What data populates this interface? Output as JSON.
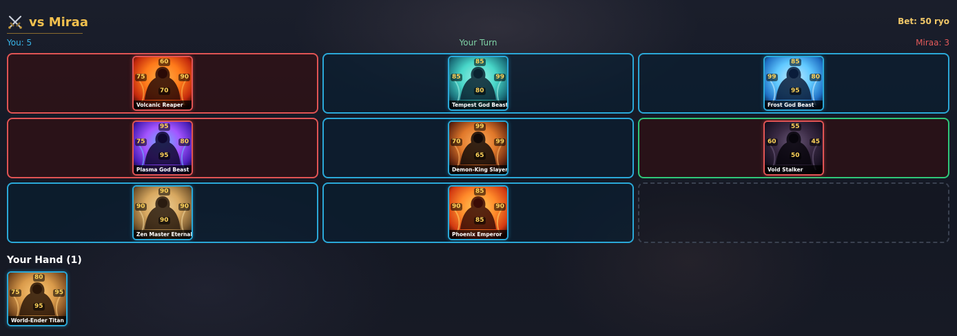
{
  "header": {
    "title_icon": "crossed-swords-icon",
    "title": "vs Miraa",
    "bet": "Bet: 50 ryo"
  },
  "status": {
    "you_score": "You: 5",
    "turn": "Your Turn",
    "opponent_score": "Miraa: 3"
  },
  "colors": {
    "player": "#2aa8d8",
    "opponent": "#e05454",
    "highlight": "#2fc77a",
    "gold": "#f2c04e"
  },
  "board": {
    "cells": [
      {
        "owner": "opponent",
        "card": {
          "name": "Volcanic Reaper",
          "top": "60",
          "left": "75",
          "right": "90",
          "bottom": "70",
          "art": "fire"
        }
      },
      {
        "owner": "player",
        "card": {
          "name": "Tempest God Beast",
          "top": "85",
          "left": "85",
          "right": "99",
          "bottom": "80",
          "art": "teal"
        }
      },
      {
        "owner": "player",
        "card": {
          "name": "Frost God Beast",
          "top": "85",
          "left": "99",
          "right": "80",
          "bottom": "95",
          "art": "ice"
        }
      },
      {
        "owner": "opponent",
        "card": {
          "name": "Plasma God Beast",
          "top": "95",
          "left": "75",
          "right": "80",
          "bottom": "95",
          "art": "plasma"
        }
      },
      {
        "owner": "player",
        "card": {
          "name": "Demon-King Slayer",
          "top": "99",
          "left": "70",
          "right": "99",
          "bottom": "65",
          "art": "ember"
        }
      },
      {
        "owner": "opponent",
        "card": {
          "name": "Void Stalker",
          "top": "55",
          "left": "60",
          "right": "45",
          "bottom": "50",
          "art": "void"
        }
      },
      {
        "owner": "player",
        "card": {
          "name": "Zen Master Eternal",
          "top": "90",
          "left": "90",
          "right": "90",
          "bottom": "90",
          "art": "zen"
        }
      },
      {
        "owner": "player",
        "card": {
          "name": "Phoenix Emperor",
          "top": "85",
          "left": "90",
          "right": "90",
          "bottom": "85",
          "art": "phoenix"
        }
      },
      {
        "owner": "empty",
        "card": null
      }
    ]
  },
  "hand": {
    "title": "Your Hand (1)",
    "cards": [
      {
        "name": "World-Ender Titan",
        "top": "80",
        "left": "75",
        "right": "95",
        "bottom": "95",
        "art": "titan"
      }
    ]
  }
}
